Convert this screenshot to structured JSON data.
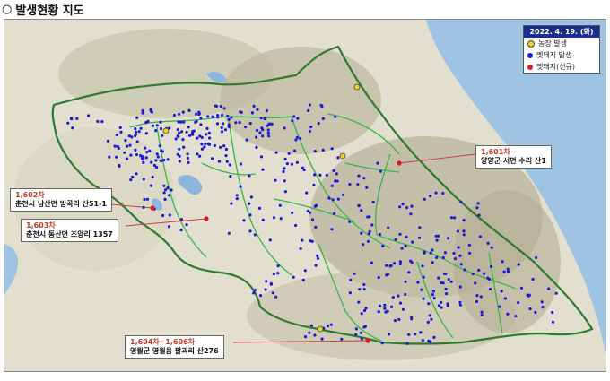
{
  "title": "발생현황 지도",
  "title_bullet": "○",
  "legend": {
    "date": "2022. 4. 19. (화)",
    "items": [
      {
        "label": "농장 발생",
        "color": "#f1d31b",
        "border": "#444"
      },
      {
        "label": "멧돼지 발생",
        "color": "#1a1ad6",
        "border": "#1a1ad6"
      },
      {
        "label": "멧돼지(신규)",
        "color": "#e01a1a",
        "border": "#e01a1a"
      }
    ]
  },
  "callouts": [
    {
      "num": "1,601차",
      "addr": "양양군 서면 수리 산1"
    },
    {
      "num": "1,602차",
      "addr": "춘천시 남산면 방곡리 산51-1"
    },
    {
      "num": "1,603차",
      "addr": "춘천시 동산면 조양리 1357"
    },
    {
      "num": "1,604차~1,606차",
      "addr": "영월군 영월읍 팔괴리 산276"
    }
  ],
  "colors": {
    "sea": "#9fc3e3",
    "boundary_outer": "#2e7a2e",
    "boundary_inner": "#39b54a",
    "callout_line": "#d23a3a"
  }
}
